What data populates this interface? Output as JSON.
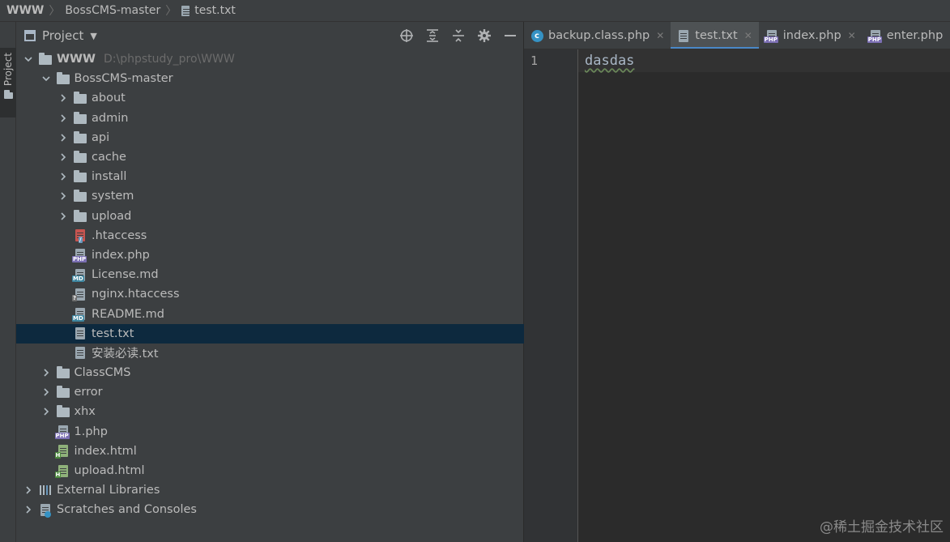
{
  "breadcrumb": {
    "items": [
      "WWW",
      "BossCMS-master",
      "test.txt"
    ]
  },
  "stripe": {
    "project_label": "Project"
  },
  "panel": {
    "title": "Project",
    "tools": [
      "locate-icon",
      "expand-all-icon",
      "collapse-all-icon",
      "gear-icon",
      "minimize-icon"
    ]
  },
  "tree": [
    {
      "label": "WWW",
      "hint": "D:\\phpstudy_pro\\WWW",
      "depth": 0,
      "expanded": true,
      "icon": "folder-icon",
      "bold": true
    },
    {
      "label": "BossCMS-master",
      "depth": 1,
      "expanded": true,
      "icon": "folder-icon"
    },
    {
      "label": "about",
      "depth": 2,
      "expanded": false,
      "icon": "folder-icon"
    },
    {
      "label": "admin",
      "depth": 2,
      "expanded": false,
      "icon": "folder-icon"
    },
    {
      "label": "api",
      "depth": 2,
      "expanded": false,
      "icon": "folder-icon"
    },
    {
      "label": "cache",
      "depth": 2,
      "expanded": false,
      "icon": "folder-icon"
    },
    {
      "label": "install",
      "depth": 2,
      "expanded": false,
      "icon": "folder-icon"
    },
    {
      "label": "system",
      "depth": 2,
      "expanded": false,
      "icon": "folder-icon"
    },
    {
      "label": "upload",
      "depth": 2,
      "expanded": false,
      "icon": "folder-icon"
    },
    {
      "label": ".htaccess",
      "depth": 2,
      "icon": "htaccess-file-icon"
    },
    {
      "label": "index.php",
      "depth": 2,
      "icon": "php-file-icon"
    },
    {
      "label": "License.md",
      "depth": 2,
      "icon": "markdown-file-icon"
    },
    {
      "label": "nginx.htaccess",
      "depth": 2,
      "icon": "unknown-file-icon"
    },
    {
      "label": "README.md",
      "depth": 2,
      "icon": "markdown-file-icon"
    },
    {
      "label": "test.txt",
      "depth": 2,
      "icon": "text-file-icon",
      "selected": true
    },
    {
      "label": "安装必读.txt",
      "depth": 2,
      "icon": "text-file-icon"
    },
    {
      "label": "ClassCMS",
      "depth": 1,
      "expanded": false,
      "icon": "folder-icon"
    },
    {
      "label": "error",
      "depth": 1,
      "expanded": false,
      "icon": "folder-icon"
    },
    {
      "label": "xhx",
      "depth": 1,
      "expanded": false,
      "icon": "folder-icon"
    },
    {
      "label": "1.php",
      "depth": 1,
      "icon": "php-file-icon"
    },
    {
      "label": "index.html",
      "depth": 1,
      "icon": "html-file-icon"
    },
    {
      "label": "upload.html",
      "depth": 1,
      "icon": "html-file-icon"
    },
    {
      "label": "External Libraries",
      "depth": 0,
      "expanded": false,
      "icon": "libraries-icon"
    },
    {
      "label": "Scratches and Consoles",
      "depth": 0,
      "expanded": false,
      "icon": "scratches-icon"
    }
  ],
  "tabs": [
    {
      "label": "backup.class.php",
      "icon": "php-class-icon",
      "active": false,
      "closable": true
    },
    {
      "label": "test.txt",
      "icon": "text-file-icon",
      "active": true,
      "closable": true
    },
    {
      "label": "index.php",
      "icon": "php-file-icon",
      "active": false,
      "closable": true
    },
    {
      "label": "enter.php",
      "icon": "php-file-icon",
      "active": false,
      "closable": false
    }
  ],
  "editor": {
    "line_number": "1",
    "content": "dasdas"
  },
  "watermark": "@稀土掘金技术社区",
  "colors": {
    "selection": "#0d293e",
    "accent": "#4a88c7",
    "panel_bg": "#3c3f41",
    "editor_bg": "#2b2b2b"
  }
}
